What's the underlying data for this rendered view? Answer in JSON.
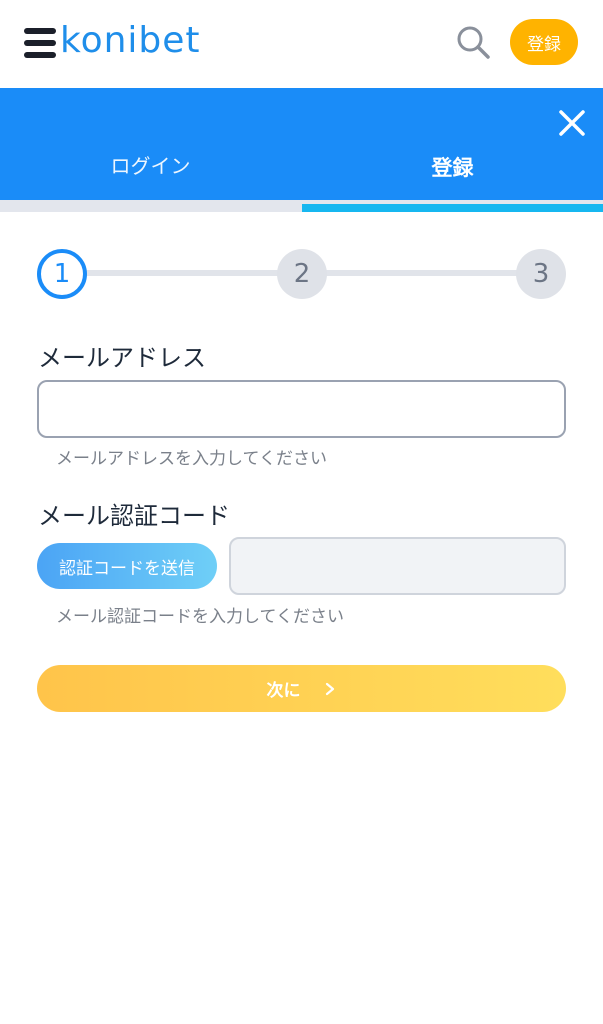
{
  "header": {
    "logo_text": "konibet",
    "register_label": "登録",
    "menu_icon": "hamburger-menu-icon",
    "search_icon": "search-icon"
  },
  "tabs": {
    "login_label": "ログイン",
    "register_label": "登録",
    "active": "register",
    "close_icon": "close-icon"
  },
  "stepper": {
    "steps": [
      "1",
      "2",
      "3"
    ],
    "current": 1
  },
  "form": {
    "email": {
      "label": "メールアドレス",
      "value": "",
      "placeholder": "",
      "hint": "メールアドレスを入力してください"
    },
    "code": {
      "label": "メール認証コード",
      "send_button_label": "認証コードを送信",
      "value": "",
      "placeholder": "",
      "hint": "メール認証コードを入力してください"
    },
    "next_label": "次に",
    "next_icon": "chevron-right-icon"
  },
  "colors": {
    "primary_blue": "#1a8cf8",
    "accent_cyan": "#17b7f0",
    "register_orange": "#ffb300",
    "next_yellow": "#ffd04f"
  }
}
